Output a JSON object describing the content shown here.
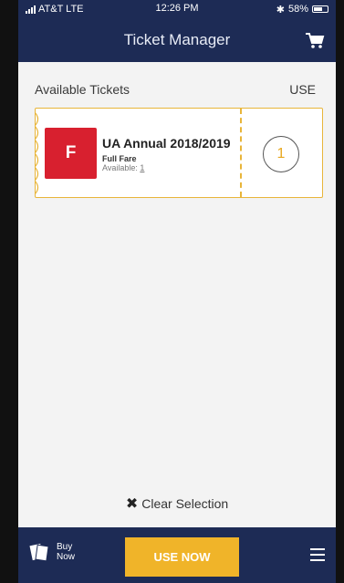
{
  "status_bar": {
    "carrier": "AT&T LTE",
    "time": "12:26 PM",
    "battery": "58%"
  },
  "header": {
    "title": "Ticket Manager",
    "cart_icon": "cart-icon"
  },
  "list_header": {
    "left": "Available Tickets",
    "right": "USE"
  },
  "ticket": {
    "badge": "F",
    "badge_color": "#d8202f",
    "name": "UA Annual 2018/2019",
    "fare_type": "Full Fare",
    "available_label": "Available:",
    "available_count": "1",
    "use_count": "1",
    "accent_color": "#e8b53a"
  },
  "clear_selection": {
    "icon": "x-icon",
    "label": "Clear Selection"
  },
  "bottom_bar": {
    "buy_now_line1": "Buy",
    "buy_now_line2": "Now",
    "use_now": "USE NOW",
    "menu_icon": "hamburger-icon",
    "bar_color": "#1d2b55",
    "button_color": "#f0b429"
  }
}
